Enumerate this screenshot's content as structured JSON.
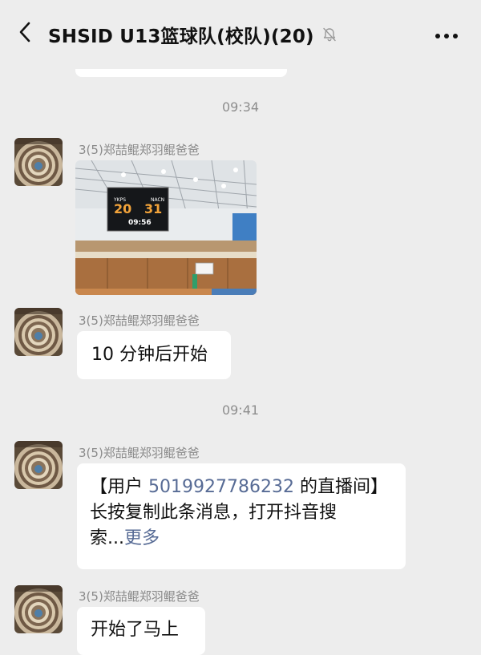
{
  "header": {
    "title": "SHSID U13篮球队(校队)(20)",
    "back_icon": "chevron-left-icon",
    "mute_icon": "bell-off-icon",
    "more_icon": "more-horizontal-icon"
  },
  "messages": {
    "time1": "09:34",
    "sender1": "3(5)郑喆鲲郑羽鲲爸爸",
    "scoreboard": {
      "home": "YKPS",
      "away": "NACN",
      "home_score": "20",
      "away_score": "31",
      "clock": "09:56"
    },
    "sender2": "3(5)郑喆鲲郑羽鲲爸爸",
    "text2": "10 分钟后开始",
    "time2": "09:41",
    "sender3": "3(5)郑喆鲲郑羽鲲爸爸",
    "share": {
      "prefix": "【用户 ",
      "user_id": "5019927786232",
      "suffix": " 的直播间】",
      "line2": "长按复制此条消息，打开抖音搜",
      "line3": "索...",
      "more": "更多"
    },
    "sender4": "3(5)郑喆鲲郑羽鲲爸爸",
    "text4": "开始了马上"
  },
  "colors": {
    "background": "#ededed",
    "bubble": "#ffffff",
    "link": "#576b95",
    "meta": "#8d8d8d"
  }
}
